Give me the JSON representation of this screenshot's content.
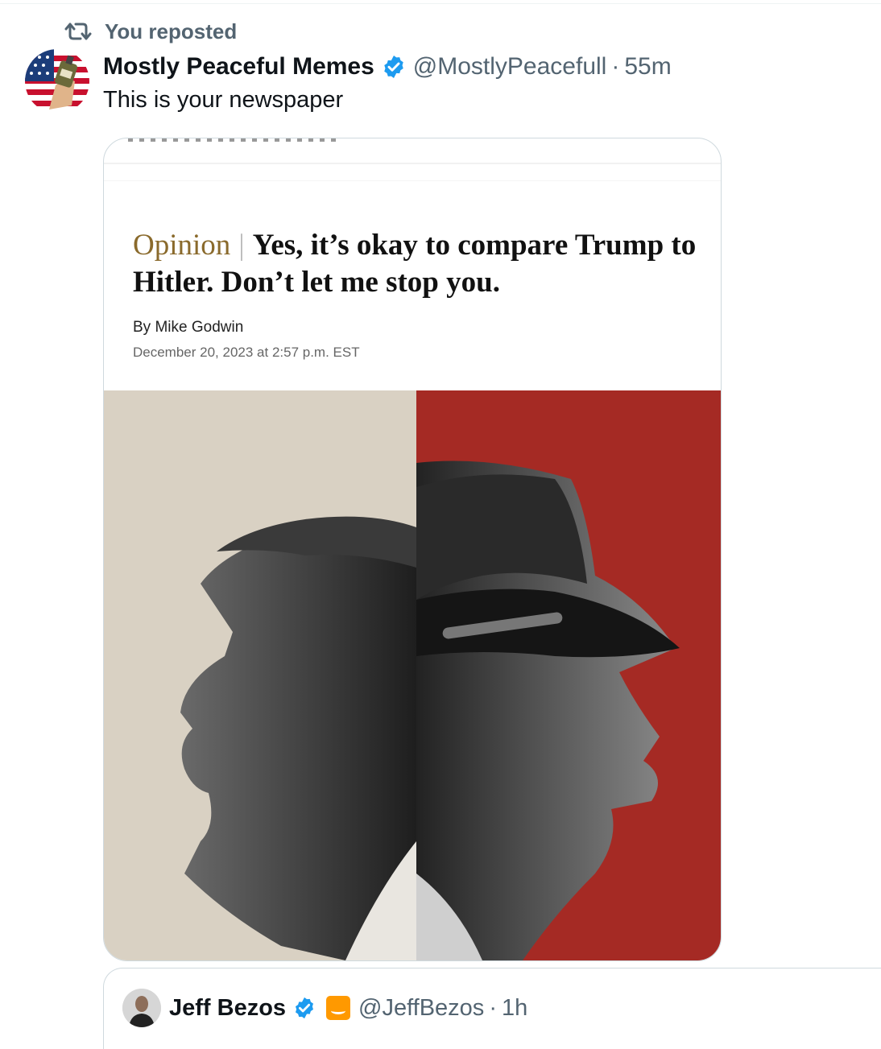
{
  "repost": {
    "label": "You reposted"
  },
  "tweet": {
    "display_name": "Mostly Peaceful Memes",
    "handle": "@MostlyPeacefull",
    "separator": "·",
    "time": "55m",
    "text": "This is your newspaper"
  },
  "article": {
    "kicker": "Opinion",
    "divider": "|",
    "headline": "Yes, it’s okay to compare Trump to Hitler. Don’t let me stop you.",
    "byline": "By Mike Godwin",
    "date": "December 20, 2023 at 2:57 p.m. EST"
  },
  "quoted": {
    "display_name": "Jeff Bezos",
    "handle": "@JeffBezos",
    "separator": "·",
    "time": "1h"
  },
  "colors": {
    "verified_blue": "#1d9bf0",
    "muted_text": "#536471",
    "art_left_bg": "#d9d1c3",
    "art_right_bg": "#a52a24",
    "kicker_gold": "#8a6a2c"
  },
  "icons": [
    "repost-icon",
    "verified-badge-icon",
    "amazon-badge-icon"
  ]
}
